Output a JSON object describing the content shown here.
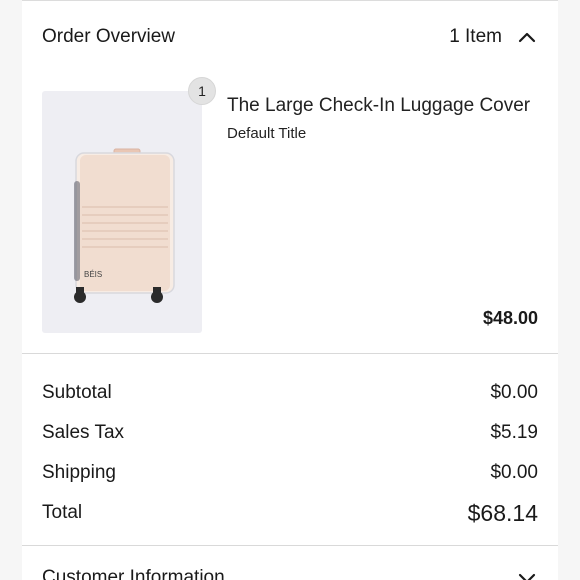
{
  "order_overview": {
    "title": "Order Overview",
    "item_count": "1 Item",
    "expand_icon": "chevron-up-icon"
  },
  "product": {
    "quantity": "1",
    "name": "The Large Check-In Luggage Cover",
    "variant": "Default Title",
    "price": "$48.00",
    "brand_mark": "BÉIS"
  },
  "summary": {
    "rows": [
      {
        "label": "Subtotal",
        "value": "$0.00"
      },
      {
        "label": "Sales Tax",
        "value": "$5.19"
      },
      {
        "label": "Shipping",
        "value": "$0.00"
      },
      {
        "label": "Total",
        "value": "$68.14"
      }
    ]
  },
  "customer_section": {
    "title": "Customer Information",
    "expand_icon": "chevron-down-icon"
  },
  "colors": {
    "page_bg": "#f6f6f6",
    "panel_bg": "#ffffff",
    "thumb_bg": "#eeeef3",
    "luggage": "#f1ddd0"
  }
}
